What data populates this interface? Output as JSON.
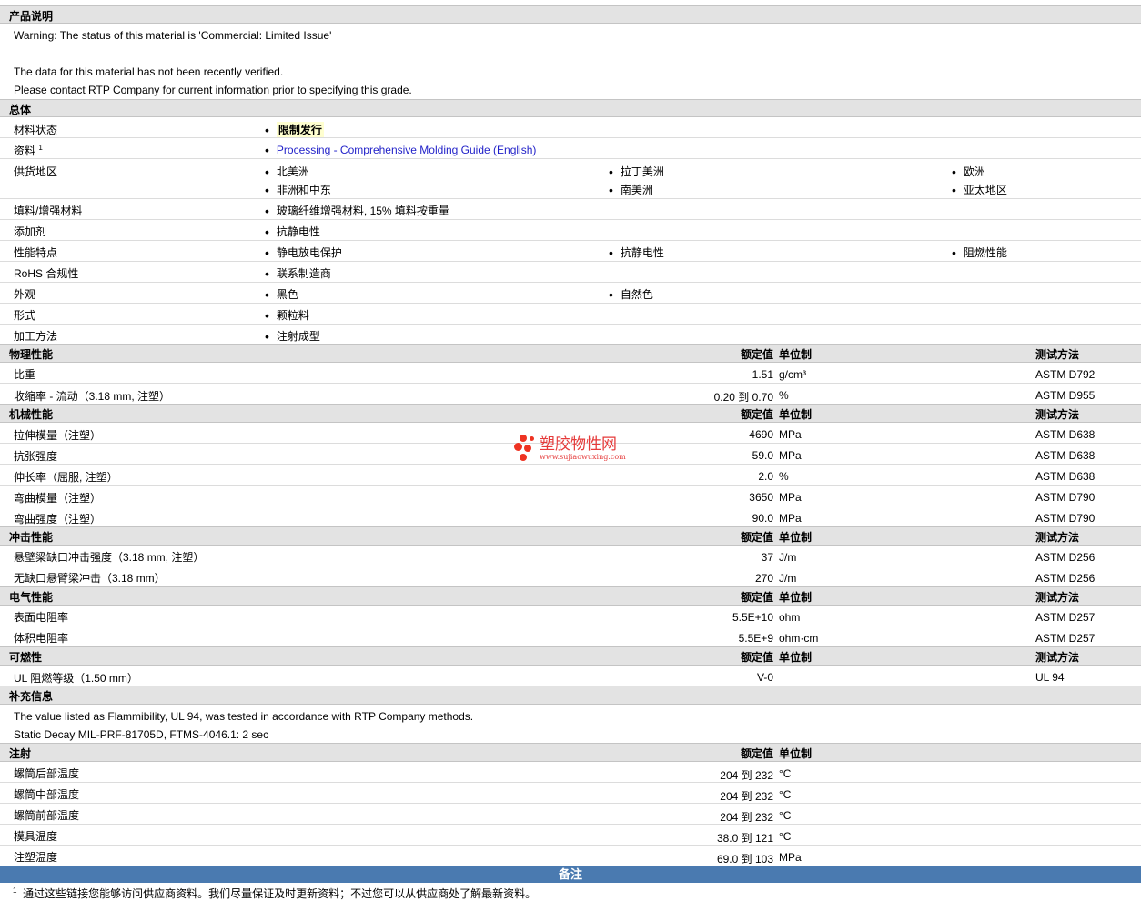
{
  "description": {
    "title": "产品说明",
    "lines": [
      "Warning: The status of this material is 'Commercial: Limited Issue'",
      "The data for this material has not been recently verified.",
      "Please contact RTP Company for current information prior to specifying this grade."
    ]
  },
  "general": {
    "title": "总体",
    "material_status_label": "材料状态",
    "material_status_value": "限制发行",
    "docs_label": "资料",
    "docs_sup": "1",
    "docs_link": "Processing - Comprehensive Molding Guide (English)",
    "supply_label": "供货地区",
    "supply": [
      "北美洲",
      "拉丁美洲",
      "欧洲",
      "非洲和中东",
      "南美洲",
      "亚太地区"
    ],
    "filler_label": "填料/增强材料",
    "filler_value": "玻璃纤维增强材料, 15% 填料按重量",
    "additive_label": "添加剂",
    "additive_value": "抗静电性",
    "features_label": "性能特点",
    "features": [
      "静电放电保护",
      "抗静电性",
      "阻燃性能"
    ],
    "rohs_label": "RoHS 合规性",
    "rohs_value": "联系制造商",
    "appearance_label": "外观",
    "appearance": [
      "黑色",
      "自然色"
    ],
    "form_label": "形式",
    "form_value": "颗粒料",
    "process_label": "加工方法",
    "process_value": "注射成型"
  },
  "headers": {
    "nominal": "额定值",
    "unit": "单位制",
    "method": "测试方法"
  },
  "physical": {
    "title": "物理性能",
    "rows": [
      {
        "name": "比重",
        "value": "1.51",
        "unit": "g/cm³",
        "method": "ASTM D792"
      },
      {
        "name": "收缩率  - 流动（3.18 mm, 注塑）",
        "value": "0.20 到  0.70",
        "unit": "%",
        "method": "ASTM D955"
      }
    ]
  },
  "mechanical": {
    "title": "机械性能",
    "rows": [
      {
        "name": "拉伸模量（注塑）",
        "value": "4690",
        "unit": "MPa",
        "method": "ASTM D638"
      },
      {
        "name": "抗张强度",
        "value": "59.0",
        "unit": "MPa",
        "method": "ASTM D638"
      },
      {
        "name": "伸长率（屈服, 注塑）",
        "value": "2.0",
        "unit": "%",
        "method": "ASTM D638"
      },
      {
        "name": "弯曲模量（注塑）",
        "value": "3650",
        "unit": "MPa",
        "method": "ASTM D790"
      },
      {
        "name": "弯曲强度（注塑）",
        "value": "90.0",
        "unit": "MPa",
        "method": "ASTM D790"
      }
    ]
  },
  "impact": {
    "title": "冲击性能",
    "rows": [
      {
        "name": "悬壁梁缺口冲击强度（3.18 mm, 注塑）",
        "value": "37",
        "unit": "J/m",
        "method": "ASTM D256"
      },
      {
        "name": "无缺口悬臂梁冲击（3.18 mm）",
        "value": "270",
        "unit": "J/m",
        "method": "ASTM D256"
      }
    ]
  },
  "electrical": {
    "title": "电气性能",
    "rows": [
      {
        "name": "表面电阻率",
        "value": "5.5E+10",
        "unit": "ohm",
        "method": "ASTM D257"
      },
      {
        "name": "体积电阻率",
        "value": "5.5E+9",
        "unit": "ohm·cm",
        "method": "ASTM D257"
      }
    ]
  },
  "flammability": {
    "title": "可燃性",
    "rows": [
      {
        "name": "UL 阻燃等级（1.50 mm）",
        "value": "V-0",
        "unit": "",
        "method": "UL 94"
      }
    ]
  },
  "supplemental": {
    "title": "补充信息",
    "lines": [
      "The value listed as Flammibility, UL 94, was tested in accordance with RTP Company methods.",
      "Static Decay MIL-PRF-81705D, FTMS-4046.1: 2 sec"
    ]
  },
  "injection": {
    "title": "注射",
    "rows": [
      {
        "name": "螺筒后部温度",
        "value": "204 到  232",
        "unit": "°C"
      },
      {
        "name": "螺筒中部温度",
        "value": "204 到  232",
        "unit": "°C"
      },
      {
        "name": "螺筒前部温度",
        "value": "204 到  232",
        "unit": "°C"
      },
      {
        "name": "模具温度",
        "value": "38.0 到  121",
        "unit": "°C"
      },
      {
        "name": "注塑温度",
        "value": "69.0 到  103",
        "unit": "MPa"
      }
    ]
  },
  "footer": {
    "title": "备注",
    "note_sup": "1",
    "note": "通过这些链接您能够访问供应商资料。我们尽量保证及时更新资料；不过您可以从供应商处了解最新资料。"
  },
  "watermark": {
    "cn": "塑胶物性网",
    "en": "www.sujiaowuxing.com"
  }
}
